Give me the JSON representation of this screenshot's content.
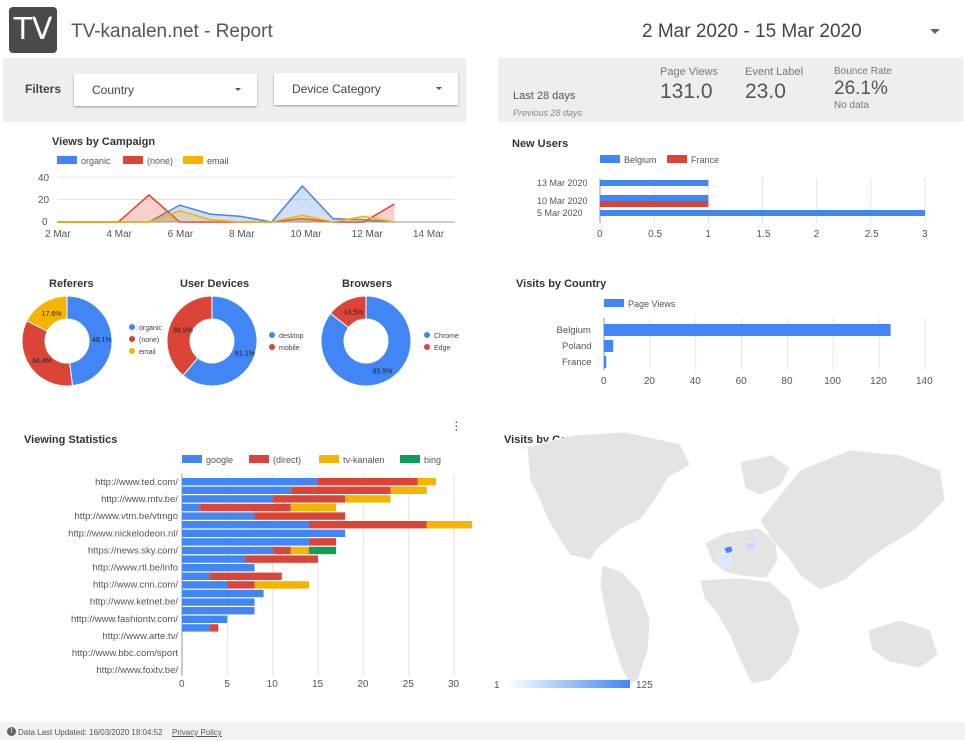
{
  "header": {
    "logo_text": "TV",
    "title": "TV-kanalen.net - Report",
    "date_range": "2 Mar 2020 - 15 Mar 2020"
  },
  "filters": {
    "label": "Filters",
    "country": "Country",
    "device": "Device Category"
  },
  "scorecards": {
    "period": "Last 28 days",
    "previous": "Previous 28 days",
    "items": [
      {
        "label": "Page Views",
        "value": "131.0"
      },
      {
        "label": "Event Label",
        "value": "23.0"
      },
      {
        "label": "Bounce Rate",
        "value": "26.1%",
        "sub": "No data"
      }
    ]
  },
  "footer": {
    "updated": "Data Last Updated: 16/03/2020 18:04:52",
    "privacy": "Privacy Policy"
  },
  "colors": {
    "blue": "#4285f4",
    "red": "#db4437",
    "yellow": "#f4b400",
    "green": "#0f9d58"
  },
  "chart_data": [
    {
      "id": "views_by_campaign",
      "type": "area",
      "title": "Views by Campaign",
      "x": [
        "2 Mar",
        "3 Mar",
        "4 Mar",
        "5 Mar",
        "6 Mar",
        "7 Mar",
        "8 Mar",
        "9 Mar",
        "10 Mar",
        "11 Mar",
        "12 Mar",
        "13 Mar"
      ],
      "xticks": [
        "2 Mar",
        "4 Mar",
        "6 Mar",
        "8 Mar",
        "10 Mar",
        "12 Mar",
        "14 Mar"
      ],
      "ylim": [
        0,
        40
      ],
      "yticks": [
        "40",
        "20",
        "0"
      ],
      "series": [
        {
          "name": "organic",
          "values": [
            0,
            0,
            0,
            0,
            15,
            7,
            5,
            0,
            32,
            3,
            2,
            0
          ]
        },
        {
          "name": "(none)",
          "values": [
            0,
            0,
            0,
            24,
            0,
            0,
            0,
            0,
            3,
            0,
            0,
            16
          ]
        },
        {
          "name": "email",
          "values": [
            0,
            0,
            0,
            0,
            10,
            2,
            0,
            0,
            6,
            0,
            5,
            0
          ]
        }
      ]
    },
    {
      "id": "new_users",
      "type": "bar",
      "title": "New Users",
      "categories": [
        "13 Mar 2020",
        "10 Mar 2020",
        "5 Mar 2020"
      ],
      "xticks": [
        "0",
        "0.5",
        "1",
        "1.5",
        "2",
        "2.5",
        "3"
      ],
      "xlim": [
        0,
        3
      ],
      "series": [
        {
          "name": "Belgium",
          "values": [
            1,
            1,
            3
          ]
        },
        {
          "name": "France",
          "values": [
            0,
            1,
            0
          ]
        }
      ]
    },
    {
      "id": "referers",
      "type": "pie",
      "title": "Referers",
      "slices": [
        {
          "name": "organic",
          "value": 48.1,
          "label": "48.1%"
        },
        {
          "name": "(none)",
          "value": 34.4,
          "label": "34.4%"
        },
        {
          "name": "email",
          "value": 17.6,
          "label": "17.6%"
        }
      ]
    },
    {
      "id": "user_devices",
      "type": "pie",
      "title": "User Devices",
      "slices": [
        {
          "name": "desktop",
          "value": 61.1,
          "label": "61.1%"
        },
        {
          "name": "mobile",
          "value": 38.9,
          "label": "38.9%"
        }
      ]
    },
    {
      "id": "browsers",
      "type": "pie",
      "title": "Browsers",
      "slices": [
        {
          "name": "Chrome",
          "value": 85.5,
          "label": "85.5%"
        },
        {
          "name": "Edge",
          "value": 14.5,
          "label": "14.5%"
        }
      ]
    },
    {
      "id": "visits_by_country_bar",
      "type": "bar",
      "title": "Visits by Country",
      "categories": [
        "Belgium",
        "Poland",
        "France"
      ],
      "xticks": [
        "0",
        "20",
        "40",
        "60",
        "80",
        "100",
        "120",
        "140"
      ],
      "xlim": [
        0,
        140
      ],
      "series": [
        {
          "name": "Page Views",
          "values": [
            125,
            4,
            1
          ]
        }
      ]
    },
    {
      "id": "viewing_statistics",
      "type": "bar",
      "title": "Viewing Statistics",
      "categories": [
        "http://www.ted.com/",
        "http://www.mtv.be/",
        "http://www.vtm.be/vtmgo",
        "http://www.nickelodeon.nl/",
        "https://news.sky.com/",
        "http://www.rtl.be/info",
        "http://www.cnn.com/",
        "http://www.ketnet.be/",
        "http://www.fashiontv.com/",
        "http://www.arte.tv/",
        "http://www.bbc.com/sport",
        "http://www.foxtv.be/"
      ],
      "xticks": [
        "0",
        "5",
        "10",
        "15",
        "20",
        "25",
        "30"
      ],
      "xlim": [
        0,
        30
      ],
      "series": [
        {
          "name": "google",
          "values": [
            15,
            12,
            10,
            2,
            8,
            14,
            18,
            14,
            10,
            7,
            8,
            3,
            5,
            9,
            8,
            8,
            5,
            3
          ]
        },
        {
          "name": "(direct)",
          "values": [
            11,
            11,
            8,
            10,
            10,
            13,
            0,
            3,
            2,
            8,
            0,
            8,
            3,
            0,
            0,
            0,
            0,
            1
          ]
        },
        {
          "name": "tv-kanalen",
          "values": [
            2,
            4,
            5,
            5,
            0,
            5,
            0,
            0,
            2,
            0,
            0,
            0,
            6,
            0,
            0,
            0,
            0,
            0
          ]
        },
        {
          "name": "bing",
          "values": [
            0,
            0,
            0,
            0,
            0,
            0,
            0,
            0,
            3,
            0,
            0,
            0,
            0,
            0,
            0,
            0,
            0,
            0
          ]
        }
      ]
    },
    {
      "id": "visits_by_country_map",
      "type": "heatmap",
      "title": "Visits by Country",
      "scale_min": "1",
      "scale_max": "125",
      "regions": [
        {
          "name": "Belgium",
          "value": 125
        },
        {
          "name": "Poland",
          "value": 4
        },
        {
          "name": "France",
          "value": 1
        }
      ]
    }
  ]
}
